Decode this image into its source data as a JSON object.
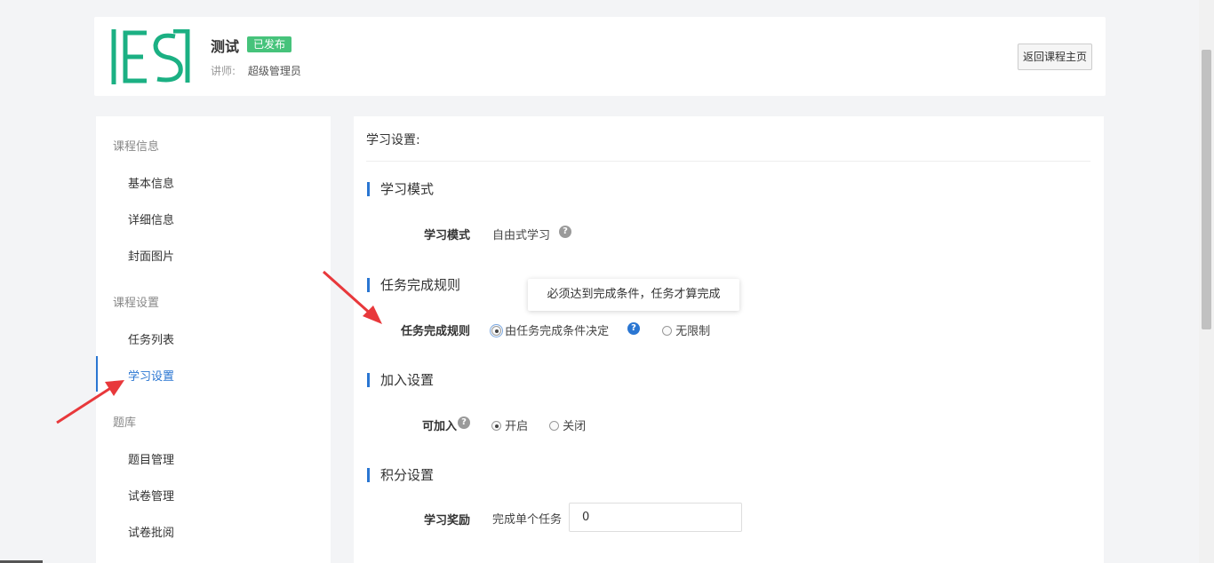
{
  "header": {
    "course_title": "测试",
    "status_badge": "已发布",
    "teacher_label": "讲师:",
    "teacher_name": "超级管理员",
    "back_button": "返回课程主页"
  },
  "sidebar": {
    "groups": [
      {
        "label": "课程信息",
        "items": [
          "基本信息",
          "详细信息",
          "封面图片"
        ]
      },
      {
        "label": "课程设置",
        "items": [
          "任务列表",
          "学习设置"
        ]
      },
      {
        "label": "题库",
        "items": [
          "题目管理",
          "试卷管理",
          "试卷批阅"
        ]
      }
    ],
    "active_item": "学习设置"
  },
  "main": {
    "heading": "学习设置:",
    "sections": {
      "learning_mode": {
        "title": "学习模式",
        "label": "学习模式",
        "value": "自由式学习"
      },
      "task_rule": {
        "title": "任务完成规则",
        "label": "任务完成规则",
        "options": [
          "由任务完成条件决定",
          "无限制"
        ],
        "selected": "由任务完成条件决定",
        "tooltip": "必须达到完成条件，任务才算完成"
      },
      "join": {
        "title": "加入设置",
        "label": "可加入",
        "options": [
          "开启",
          "关闭"
        ],
        "selected": "开启"
      },
      "points": {
        "title": "积分设置",
        "label": "学习奖励",
        "prefix": "完成单个任务",
        "value": "0"
      }
    }
  },
  "colors": {
    "accent": "#2a76d2",
    "badge": "#46c37b",
    "annotation_arrow": "#e8383b"
  },
  "icons": [
    "help-icon",
    "radio-icon",
    "arrow-annotation"
  ]
}
